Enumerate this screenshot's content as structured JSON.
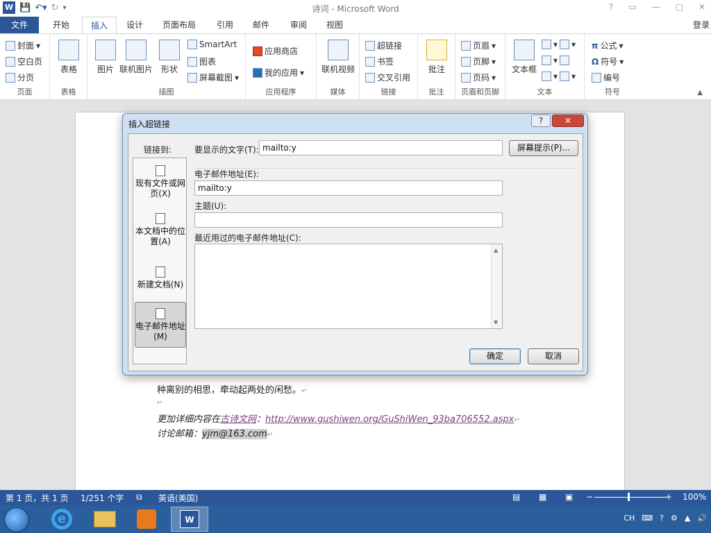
{
  "app": {
    "title": "诗词 - Microsoft Word",
    "login": "登录",
    "win_controls": [
      "?",
      "▭",
      "—",
      "▢",
      "✕"
    ]
  },
  "ribbon": {
    "tabs": [
      "文件",
      "开始",
      "插入",
      "设计",
      "页面布局",
      "引用",
      "邮件",
      "审阅",
      "视图"
    ],
    "active_tab": "插入",
    "groups": {
      "pages": {
        "label": "页面",
        "items": [
          "封面",
          "空白页",
          "分页"
        ]
      },
      "tables": {
        "label": "表格",
        "item": "表格"
      },
      "illustrations": {
        "label": "插图",
        "items": [
          "图片",
          "联机图片",
          "形状",
          "SmartArt",
          "图表",
          "屏幕截图"
        ]
      },
      "apps": {
        "label": "应用程序",
        "items": [
          "应用商店",
          "我的应用"
        ]
      },
      "media": {
        "label": "媒体",
        "item": "联机视频"
      },
      "links": {
        "label": "链接",
        "items": [
          "超链接",
          "书签",
          "交叉引用"
        ]
      },
      "comments": {
        "label": "批注",
        "item": "批注"
      },
      "header_footer": {
        "label": "页眉和页脚",
        "items": [
          "页眉",
          "页脚",
          "页码"
        ]
      },
      "text": {
        "label": "文本",
        "item": "文本框"
      },
      "symbols": {
        "label": "符号",
        "items": [
          "公式",
          "符号",
          "编号"
        ]
      }
    }
  },
  "document": {
    "line1": "种离别的相思，牵动起两处的闲愁。",
    "line3_prefix": "更加详细内容在",
    "line3_link_text": "古诗文网",
    "line3_sep": "：",
    "line3_url": "http://www.gushiwen.org/GuShiWen_93ba706552.aspx",
    "line4_prefix": "讨论邮箱：",
    "line4_email": "yjm@163.com"
  },
  "dialog": {
    "title": "插入超链接",
    "help": "?",
    "close": "✕",
    "link_to_label": "链接到:",
    "link_options": [
      {
        "label_line1": "现有文件或网",
        "label_line2": "页(X)"
      },
      {
        "label_line1": "本文档中的位",
        "label_line2": "置(A)"
      },
      {
        "label_line1": "新建文档(N)",
        "label_line2": ""
      },
      {
        "label_line1": "电子邮件地址",
        "label_line2": "(M)"
      }
    ],
    "selected_option": 3,
    "display_text_label": "要显示的文字(T):",
    "display_text_value": "mailto:y",
    "screentip_button": "屏幕提示(P)...",
    "email_label": "电子邮件地址(E):",
    "email_value": "mailto:y",
    "subject_label": "主题(U):",
    "subject_value": "",
    "recent_label": "最近用过的电子邮件地址(C):",
    "ok_button": "确定",
    "cancel_button": "取消"
  },
  "statusbar": {
    "page": "第 1 页，共 1 页",
    "words": "1/251 个字",
    "language": "英语(美国)",
    "zoom": "100%"
  },
  "taskbar": {
    "ime": "CH"
  },
  "colors": {
    "brand": "#2b579a",
    "link": "#7a3c80",
    "taskbar": "#2a5f9c"
  }
}
